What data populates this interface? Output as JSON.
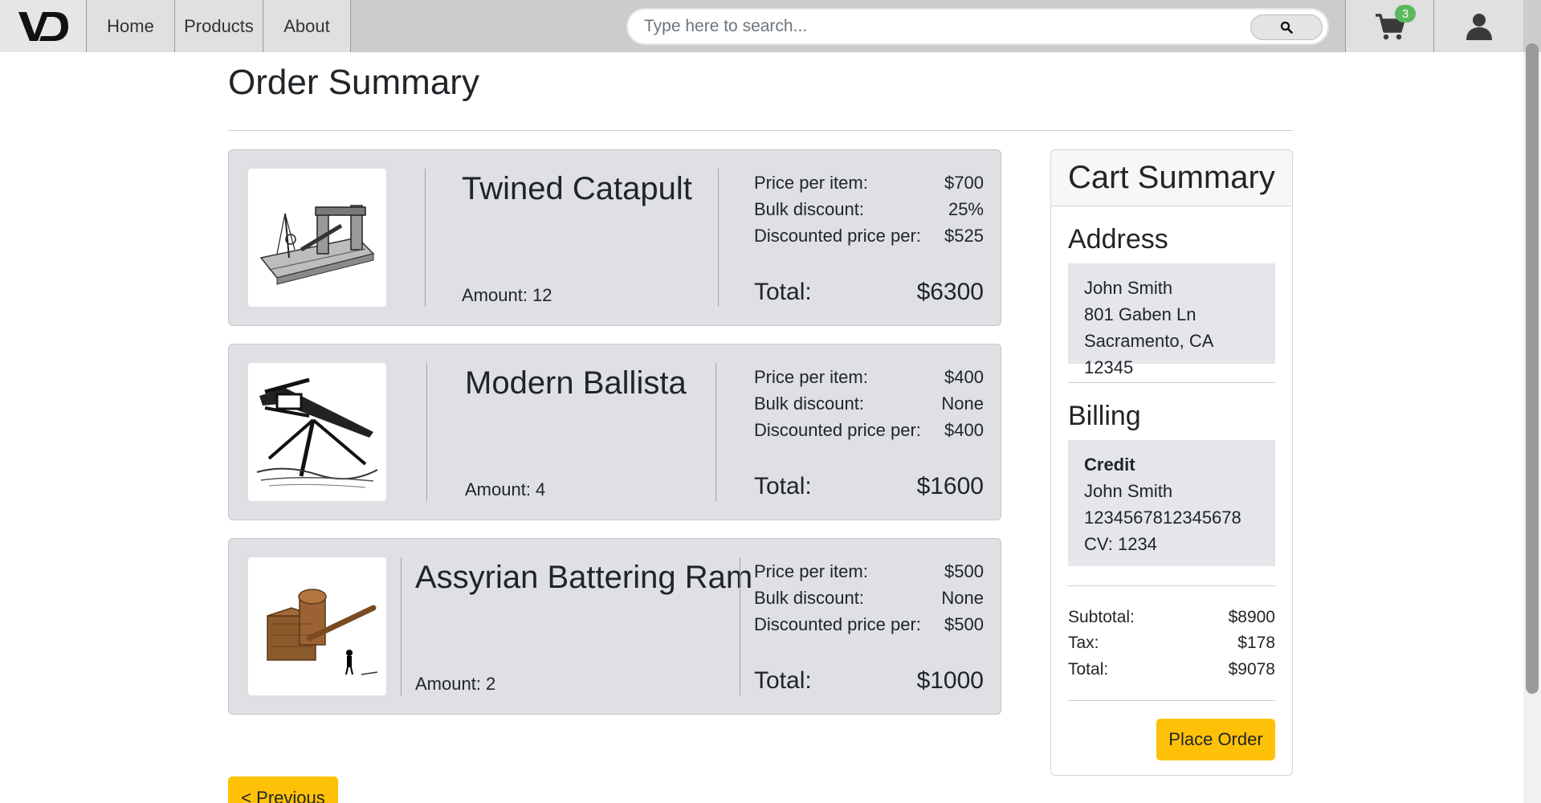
{
  "nav": {
    "logo_text": "VD",
    "links": [
      {
        "label": "Home"
      },
      {
        "label": "Products"
      },
      {
        "label": "About"
      }
    ],
    "search": {
      "placeholder": "Type here to search..."
    },
    "cart_count": "3"
  },
  "page_title": "Order Summary",
  "items": [
    {
      "name": "Twined Catapult",
      "amount": "Amount: 12",
      "price_per_item_label": "Price per item:",
      "price_per_item": "$700",
      "bulk_discount_label": "Bulk discount:",
      "bulk_discount": "25%",
      "discounted_label": "Discounted price per:",
      "discounted_price": "$525",
      "total_label": "Total:",
      "total": "$6300"
    },
    {
      "name": "Modern Ballista",
      "amount": "Amount: 4",
      "price_per_item_label": "Price per item:",
      "price_per_item": "$400",
      "bulk_discount_label": "Bulk discount:",
      "bulk_discount": "None",
      "discounted_label": "Discounted price per:",
      "discounted_price": "$400",
      "total_label": "Total:",
      "total": "$1600"
    },
    {
      "name": "Assyrian Battering Ram",
      "amount": "Amount: 2",
      "price_per_item_label": "Price per item:",
      "price_per_item": "$500",
      "bulk_discount_label": "Bulk discount:",
      "bulk_discount": "None",
      "discounted_label": "Discounted price per:",
      "discounted_price": "$500",
      "total_label": "Total:",
      "total": "$1000"
    }
  ],
  "cart_summary": {
    "title": "Cart Summary",
    "address_heading": "Address",
    "address_lines": [
      "John Smith",
      "801 Gaben Ln",
      "Sacramento, CA 12345"
    ],
    "billing_heading": "Billing",
    "billing_type": "Credit",
    "billing_lines": [
      "John Smith",
      "1234567812345678",
      "CV: 1234"
    ],
    "subtotal_label": "Subtotal:",
    "subtotal": "$8900",
    "tax_label": "Tax:",
    "tax": "$178",
    "total_label": "Total:",
    "total": "$9078",
    "place_order_label": "Place Order"
  },
  "previous_label": "< Previous"
}
